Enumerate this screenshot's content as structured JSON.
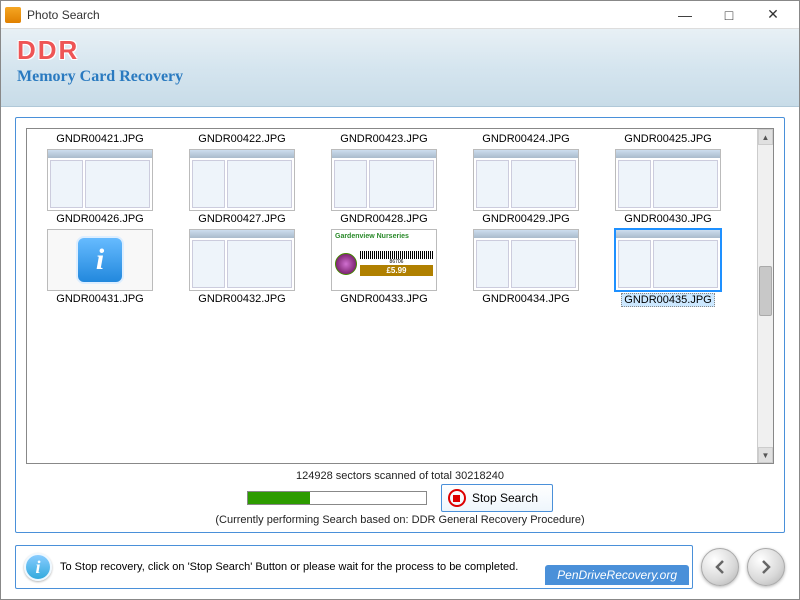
{
  "window": {
    "title": "Photo Search"
  },
  "banner": {
    "logo": "DDR",
    "subtitle": "Memory Card Recovery"
  },
  "files": [
    {
      "name": "GNDR00421.JPG",
      "thumb": "none"
    },
    {
      "name": "GNDR00422.JPG",
      "thumb": "none"
    },
    {
      "name": "GNDR00423.JPG",
      "thumb": "none"
    },
    {
      "name": "GNDR00424.JPG",
      "thumb": "none"
    },
    {
      "name": "GNDR00425.JPG",
      "thumb": "none"
    },
    {
      "name": "GNDR00426.JPG",
      "thumb": "app"
    },
    {
      "name": "GNDR00427.JPG",
      "thumb": "app"
    },
    {
      "name": "GNDR00428.JPG",
      "thumb": "app"
    },
    {
      "name": "GNDR00429.JPG",
      "thumb": "app"
    },
    {
      "name": "GNDR00430.JPG",
      "thumb": "app"
    },
    {
      "name": "GNDR00431.JPG",
      "thumb": "info"
    },
    {
      "name": "GNDR00432.JPG",
      "thumb": "app"
    },
    {
      "name": "GNDR00433.JPG",
      "thumb": "card"
    },
    {
      "name": "GNDR00434.JPG",
      "thumb": "app"
    },
    {
      "name": "GNDR00435.JPG",
      "thumb": "app",
      "selected": true
    }
  ],
  "card": {
    "title": "Gardenview Nurseries",
    "code": "86706",
    "price": "£5.99"
  },
  "progress": {
    "status": "124928 sectors scanned of total 30218240",
    "hint": "(Currently performing Search based on:  DDR General Recovery Procedure)",
    "stop_label": "Stop Search",
    "percent": 35
  },
  "footer": {
    "message": "To Stop recovery, click on 'Stop Search' Button or please wait for the process to be completed.",
    "watermark": "PenDriveRecovery.org"
  }
}
